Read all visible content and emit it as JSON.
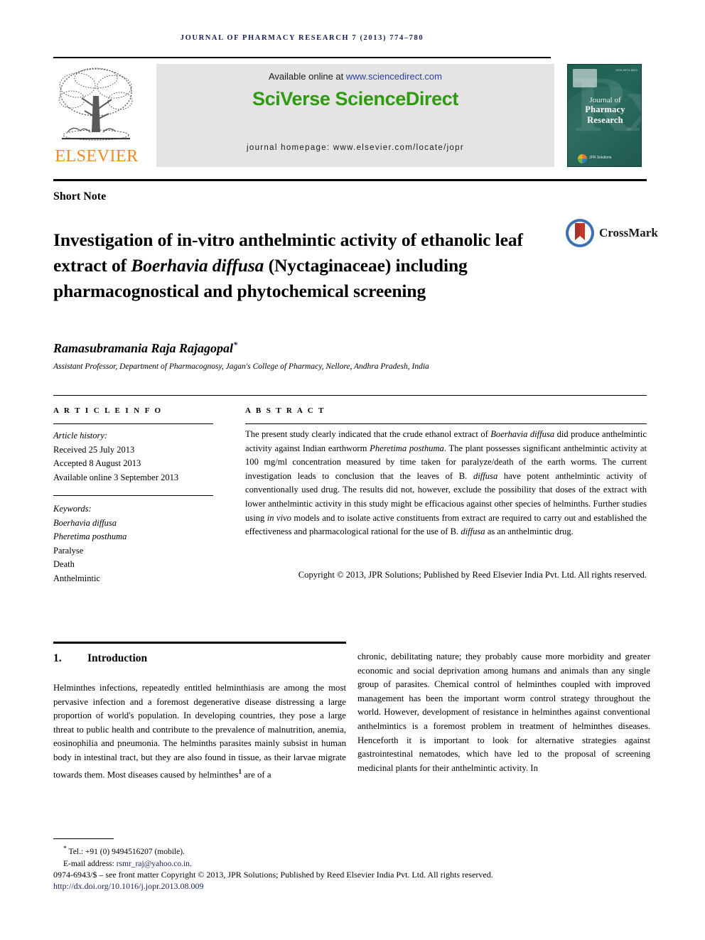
{
  "running_head": "Journal of Pharmacy Research 7 (2013) 774–780",
  "masthead": {
    "elsevier_wordmark": "ELSEVIER",
    "tree_logo_name": "elsevier-tree-logo",
    "available_prefix": "Available online at ",
    "available_url": "www.sciencedirect.com",
    "sciverse_logo": "SciVerse ScienceDirect",
    "homepage": "journal homepage: www.elsevier.com/locate/jopr",
    "sciencedirect_green": "#2E9B0E",
    "elsevier_orange": "#F08A1C",
    "banner_bg": "#E4E4E4"
  },
  "cover": {
    "issn": "ISSN 0974-6943",
    "title_line1": "Journal of",
    "title_line2": "Pharmacy Research",
    "watermark": "Rx",
    "publisher_mark": "JPR Solutions",
    "bg_color": "#1E5C4E"
  },
  "article": {
    "kicker": "Short Note",
    "title_part1": "Investigation of in-vitro anthelmintic activity of ethanolic leaf extract of ",
    "title_italic1": "Boerhavia diffusa",
    "title_part2": " (Nyctaginaceae) including pharmacognostical and phytochemical screening",
    "crossmark_label": "CrossMark",
    "author": "Ramasubramania Raja Rajagopal",
    "author_marker": "*",
    "affiliation": "Assistant Professor, Department of Pharmacognosy, Jagan's College of Pharmacy, Nellore, Andhra Pradesh, India"
  },
  "article_info": {
    "heading": "A R T I C L E   I N F O",
    "history_label": "Article history:",
    "history": [
      "Received 25 July 2013",
      "Accepted 8 August 2013",
      "Available online 3 September 2013"
    ],
    "keywords_label": "Keywords:",
    "keywords": [
      "Boerhavia diffusa",
      "Pheretima posthuma",
      "Paralyse",
      "Death",
      "Anthelmintic"
    ]
  },
  "abstract": {
    "heading": "A B S T R A C T",
    "p1_a": "The present study clearly indicated that the crude ethanol extract of ",
    "p1_i1": "Boerhavia diffusa",
    "p1_b": " did produce anthelmintic activity against Indian earthworm ",
    "p1_i2": "Pheretima posthuma",
    "p1_c": ". The plant possesses significant anthelmintic activity at 100 mg/ml concentration measured by time taken for paralyze/death of the earth worms. The current investigation leads to conclusion that the leaves of B. ",
    "p1_i3": "diffusa",
    "p1_d": " have potent anthelmintic activity of conventionally used drug. The results did not, however, exclude the possibility that doses of the extract with lower anthelmintic activity in this study might be efficacious against other species of helminths. Further studies using ",
    "p1_i4": "in vivo",
    "p1_e": " models and to isolate active constituents from extract are required to carry out and established the effectiveness and pharmacological rational for the use of B. ",
    "p1_i5": "diffusa",
    "p1_f": " as an anthelmintic drug.",
    "copyright": "Copyright © 2013, JPR Solutions; Published by Reed Elsevier India Pvt. Ltd. All rights reserved."
  },
  "introduction": {
    "number": "1.",
    "heading": "Introduction",
    "left_col": "Helminthes infections, repeatedly entitled helminthiasis are among the most pervasive infection and a foremost degenerative disease distressing a large proportion of world's population. In developing countries, they pose a large threat to public health and contribute to the prevalence of malnutrition, anemia, eosinophilia and pneumonia. The helminths parasites mainly subsist in human body in intestinal tract, but they are also found in tissue, as their larvae migrate towards them. Most diseases caused by helminthes",
    "left_col_ref": "1",
    "left_col_tail": " are of a",
    "right_col": "chronic, debilitating nature; they probably cause more morbidity and greater economic and social deprivation among humans and animals than any single group of parasites. Chemical control of helminthes coupled with improved management has been the important worm control strategy throughout the world. However, development of resistance in helminthes against conventional anthelmintics is a foremost problem in treatment of helminthes diseases. Henceforth it is important to look for alternative strategies against gastrointestinal nematodes, which have led to the proposal of screening medicinal plants for their anthelmintic activity. In"
  },
  "footer": {
    "tel_marker": "*",
    "tel": "Tel.: +91 (0) 9494516207 (mobile).",
    "email_label": "E-mail address: ",
    "email": "rsmr_raj@yahoo.co.in",
    "email_tail": ".",
    "frontmatter": "0974-6943/$ – see front matter Copyright © 2013, JPR Solutions; Published by Reed Elsevier India Pvt. Ltd. All rights reserved.",
    "doi": "http://dx.doi.org/10.1016/j.jopr.2013.08.009",
    "link_color": "#16215B"
  }
}
